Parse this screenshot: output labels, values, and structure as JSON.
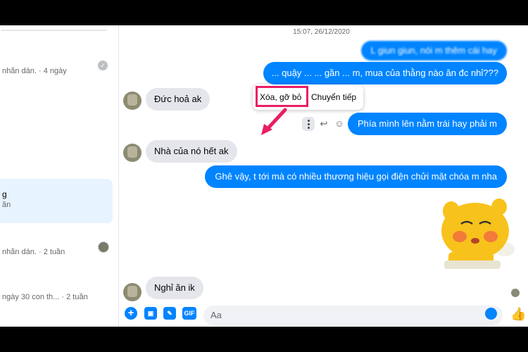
{
  "sidebar": {
    "rows": [
      {
        "text": "nhãn dán. · 4 ngày",
        "y": 0
      },
      {
        "text": "nhãn dán. · 2 tuần",
        "y": 0
      },
      {
        "text": "ngày 30 con th... · 2 tuần",
        "y": 0
      }
    ],
    "selected": {
      "line1": "g",
      "line2": "ăn"
    }
  },
  "chat": {
    "timestamp": "15:07, 26/12/2020",
    "outgoing_1": "L giun giun, nói m thêm cái hay",
    "outgoing_2": "... quậy ... ... gần ... m, mua của thằng nào ăn đc nhỉ???",
    "incoming_1": "Đức hoả ak",
    "popup_remove": "Xóa, gỡ bỏ",
    "popup_forward": "Chuyển tiếp",
    "outgoing_3": "Phía mình lên nằm trái hay phải m",
    "incoming_2": "Nhà của nó hết ak",
    "outgoing_4": "Ghê vậy, t tới mà có nhiều thương hiệu gọi điện chửi mặt chóa m nha",
    "incoming_3": "Nghỉ ăn ik"
  },
  "composer": {
    "placeholder": "Aa",
    "gif_label": "GIF"
  },
  "colors": {
    "brand": "#0084ff",
    "highlight": "#e91e63"
  },
  "icons": [
    "check-icon",
    "plus-icon",
    "image-icon",
    "sticker-icon",
    "gif-icon",
    "more-icon",
    "reply-icon",
    "react-icon",
    "emoji-icon",
    "like-icon"
  ]
}
